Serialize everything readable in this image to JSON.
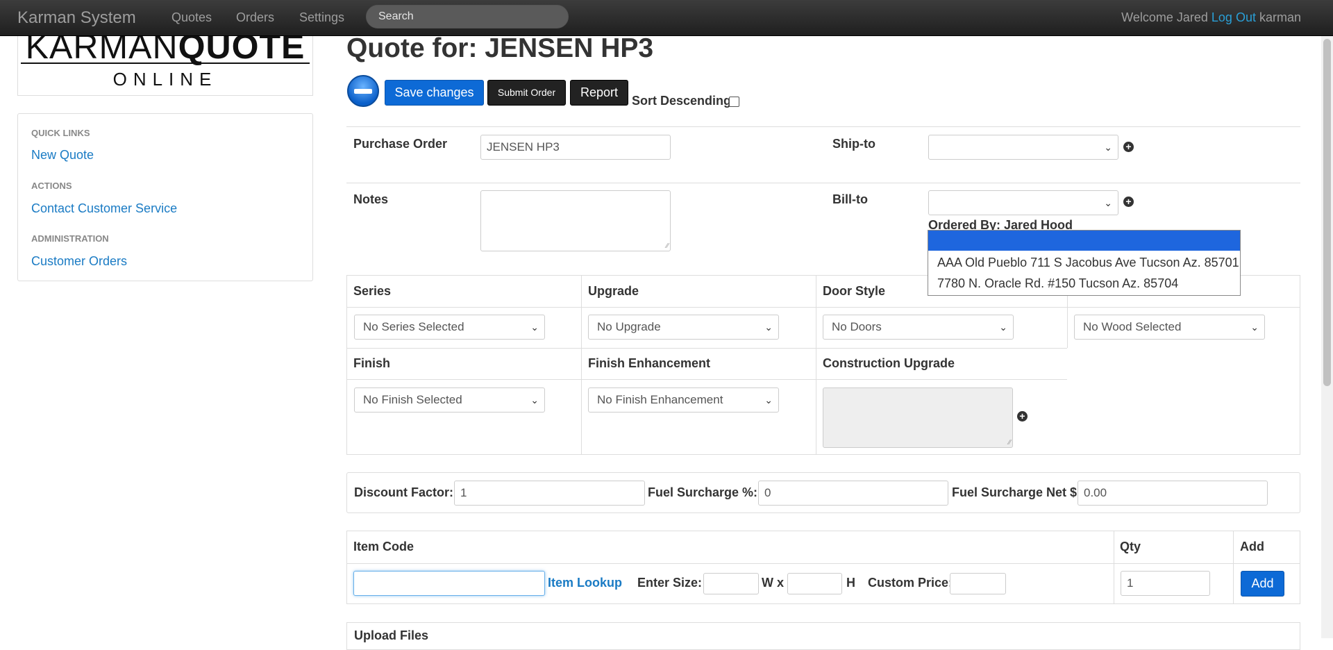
{
  "navbar": {
    "brand": "Karman System",
    "links": [
      "Quotes",
      "Orders",
      "Settings"
    ],
    "search_placeholder": "Search",
    "welcome": "Welcome Jared",
    "logout": "Log Out",
    "username": "karman"
  },
  "logo": {
    "light": "KARMAN",
    "bold": "QUOTE",
    "sub": "ONLINE"
  },
  "sidebar": {
    "quick_links_heading": "QUICK LINKS",
    "new_quote": "New Quote",
    "actions_heading": "ACTIONS",
    "contact": "Contact Customer Service",
    "admin_heading": "ADMINISTRATION",
    "customer_orders": "Customer Orders"
  },
  "quote": {
    "title": "Quote for: JENSEN HP3",
    "save": "Save changes",
    "submit": "Submit Order",
    "report": "Report",
    "sort_desc": "Sort Descending",
    "po_label": "Purchase Order",
    "po_value": "JENSEN HP3",
    "ship_label": "Ship-to",
    "notes_label": "Notes",
    "bill_label": "Bill-to",
    "ordered_by": "Ordered By: Jared Hood"
  },
  "dropdown": {
    "options": [
      "AAA Old Pueblo 711 S Jacobus Ave Tucson Az. 85701",
      "7780 N. Oracle Rd. #150 Tucson Az. 85704"
    ]
  },
  "options": {
    "series_label": "Series",
    "series_value": "No Series Selected",
    "upgrade_label": "Upgrade",
    "upgrade_value": "No Upgrade",
    "door_label": "Door Style",
    "door_value": "No Doors",
    "wood_value": "No Wood Selected",
    "finish_label": "Finish",
    "finish_value": "No Finish Selected",
    "enh_label": "Finish Enhancement",
    "enh_value": "No Finish Enhancement",
    "constr_label": "Construction Upgrade"
  },
  "pricing": {
    "discount_label": "Discount Factor:",
    "discount_value": "1",
    "fuel_pct_label": "Fuel Surcharge %:",
    "fuel_pct_value": "0",
    "fuel_net_label": "Fuel Surcharge Net $",
    "fuel_net_value": "0.00"
  },
  "items": {
    "code_header": "Item Code",
    "qty_header": "Qty",
    "add_header": "Add",
    "lookup": "Item Lookup",
    "enter_size": "Enter Size:",
    "w_x": "W x",
    "h": "H",
    "custom_price": "Custom Price:",
    "qty_value": "1",
    "add_button": "Add"
  },
  "upload": {
    "label": "Upload Files"
  },
  "icons": {
    "remove": "minus-circle-icon",
    "plus": "plus-circle-icon",
    "chevron": "chevron-down-icon"
  },
  "colors": {
    "accent": "#1a7bc4",
    "primary_button": "#0d6ad6",
    "navbar": "#222222",
    "highlight": "#1e66de"
  }
}
